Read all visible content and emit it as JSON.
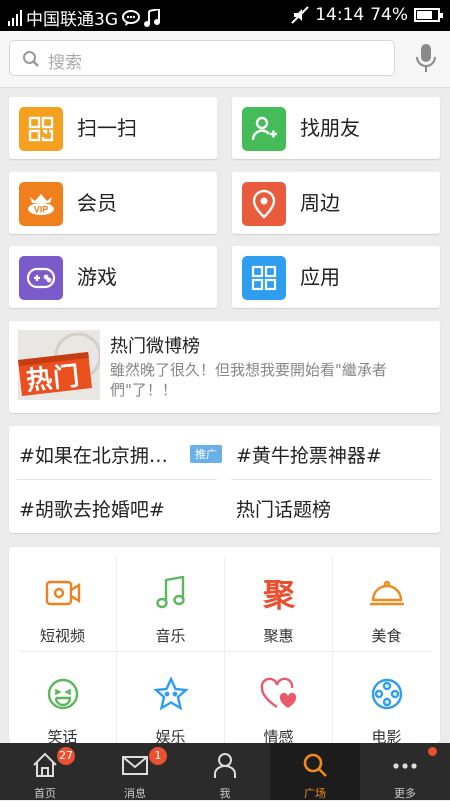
{
  "status": {
    "carrier": "中国联通3G",
    "time": "14:14",
    "battery": "74%",
    "battery_level": 0.74
  },
  "search": {
    "placeholder": "搜索"
  },
  "quick": [
    {
      "label": "扫一扫",
      "icon": "scan-icon",
      "color": "#f5a01e"
    },
    {
      "label": "找朋友",
      "icon": "add-friend-icon",
      "color": "#45bc5a"
    },
    {
      "label": "会员",
      "icon": "vip-icon",
      "color": "#f07f1e"
    },
    {
      "label": "周边",
      "icon": "location-icon",
      "color": "#ea5a3c"
    },
    {
      "label": "游戏",
      "icon": "gamepad-icon",
      "color": "#7b5bc9"
    },
    {
      "label": "应用",
      "icon": "apps-icon",
      "color": "#2e9ff0"
    }
  ],
  "hot": {
    "badge": "热门",
    "title": "热门微博榜",
    "subtitle": "雖然晚了很久！但我想我要開始看\"繼承者們\"了！！"
  },
  "topics": {
    "t1": "#如果在北京拥…",
    "promo": "推广",
    "t2": "#黄牛抢票神器#",
    "t3": "#胡歌去抢婚吧#",
    "t4": "热门话题榜"
  },
  "grid": [
    {
      "label": "短视频",
      "icon": "video-icon"
    },
    {
      "label": "音乐",
      "icon": "music-icon"
    },
    {
      "label": "聚惠",
      "icon": "deals-icon",
      "glyph": "聚"
    },
    {
      "label": "美食",
      "icon": "food-icon"
    },
    {
      "label": "笑话",
      "icon": "laugh-icon"
    },
    {
      "label": "娱乐",
      "icon": "star-icon"
    },
    {
      "label": "情感",
      "icon": "heart-icon"
    },
    {
      "label": "电影",
      "icon": "film-icon"
    }
  ],
  "tabs": [
    {
      "label": "首页",
      "badge": "27"
    },
    {
      "label": "消息",
      "badge": "1"
    },
    {
      "label": "我"
    },
    {
      "label": "广场"
    },
    {
      "label": "更多"
    }
  ],
  "colors": {
    "accent": "#f08a1a",
    "badge": "#ea4f2f"
  }
}
